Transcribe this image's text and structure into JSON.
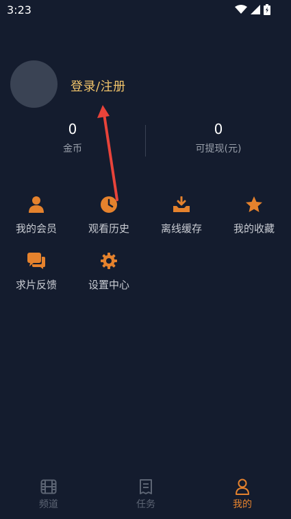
{
  "status_bar": {
    "time": "3:23"
  },
  "profile": {
    "login_label": "登录/注册"
  },
  "stats": [
    {
      "value": "0",
      "label": "金币"
    },
    {
      "value": "0",
      "label": "可提现(元)"
    }
  ],
  "menu": [
    {
      "label": "我的会员",
      "icon": "person-icon"
    },
    {
      "label": "观看历史",
      "icon": "clock-icon"
    },
    {
      "label": "离线缓存",
      "icon": "download-icon"
    },
    {
      "label": "我的收藏",
      "icon": "star-icon"
    },
    {
      "label": "求片反馈",
      "icon": "chat-icon"
    },
    {
      "label": "设置中心",
      "icon": "gear-icon"
    }
  ],
  "tabs": [
    {
      "label": "频道",
      "icon": "film-icon",
      "active": false
    },
    {
      "label": "任务",
      "icon": "task-icon",
      "active": false
    },
    {
      "label": "我的",
      "icon": "user-icon",
      "active": true
    }
  ],
  "colors": {
    "background": "#141c2e",
    "accent": "#e5822d",
    "login": "#f2c46a",
    "annotation_arrow": "#e8433a"
  }
}
